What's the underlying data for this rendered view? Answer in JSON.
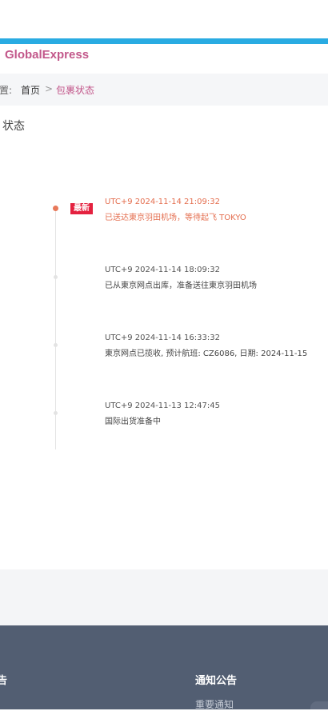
{
  "brand": {
    "name": "GlobalExpress"
  },
  "breadcrumb": {
    "prefix": "置:",
    "home": "首页",
    "separator": ">",
    "current": "包裹状态"
  },
  "page": {
    "title": "状态"
  },
  "timeline": {
    "latest_badge": "最新",
    "events": [
      {
        "time": "UTC+9 2024-11-14 21:09:32",
        "desc": "已送达東京羽田机场，等待起飞 TOKYO"
      },
      {
        "time": "UTC+9 2024-11-14 18:09:32",
        "desc": "已从東京网点出库，准备送往東京羽田机场"
      },
      {
        "time": "UTC+9 2024-11-14 16:33:32",
        "desc": "東京网点已揽收, 预计航班: CZ6086, 日期: 2024-11-15"
      },
      {
        "time": "UTC+9 2024-11-13 12:47:45",
        "desc": "国际出货准备中"
      }
    ]
  },
  "footer": {
    "left_heading": "告",
    "notice_heading": "通知公告",
    "notice_link": "重要通知"
  },
  "colors": {
    "accent_strip": "#29abe2",
    "brand": "#c2578a",
    "latest": "#e46e4f",
    "badge": "#e4213f",
    "footer": "#525e72"
  }
}
